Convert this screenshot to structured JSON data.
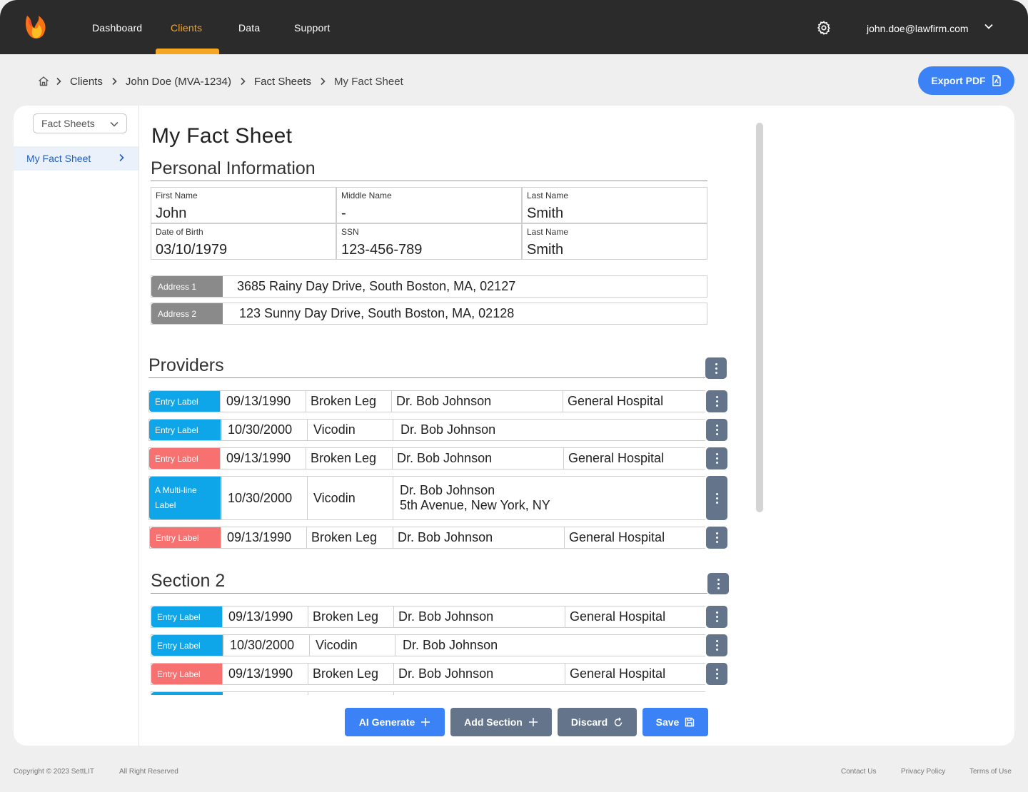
{
  "nav": {
    "items": [
      "Dashboard",
      "Clients",
      "Data",
      "Support"
    ],
    "active": "Clients",
    "user_email": "john.doe@lawfirm.com"
  },
  "breadcrumb": [
    "Clients",
    "John Doe (MVA-1234)",
    "Fact Sheets",
    "My Fact Sheet"
  ],
  "export_label": "Export PDF",
  "sidebar": {
    "select_value": "Fact Sheets",
    "items": [
      {
        "label": "My Fact Sheet"
      }
    ]
  },
  "page_title": "My Fact Sheet",
  "personal": {
    "title": "Personal Information",
    "fields": [
      {
        "label": "First Name",
        "value": "John"
      },
      {
        "label": "Middle Name",
        "value": "-"
      },
      {
        "label": "Last Name",
        "value": "Smith"
      },
      {
        "label": "Date of Birth",
        "value": "03/10/1979"
      },
      {
        "label": "SSN",
        "value": "123-456-789"
      },
      {
        "label": "Last Name",
        "value": "Smith"
      }
    ],
    "addresses": [
      {
        "label": "Address 1",
        "value": "3685 Rainy Day Drive, South Boston, MA, 02127"
      },
      {
        "label": "Address 2",
        "value": "123 Sunny Day Drive, South Boston, MA, 02128"
      }
    ]
  },
  "providers": {
    "title": "Providers",
    "rows": [
      {
        "label": "Entry Label",
        "color": "#0ea5e9",
        "date": "09/13/1990",
        "item": "Broken Leg",
        "doctor": "Dr. Bob Johnson",
        "doctor2": "",
        "place": "General Hospital"
      },
      {
        "label": "Entry Label",
        "color": "#0ea5e9",
        "date": "10/30/2000",
        "item": "Vicodin",
        "doctor": "Dr. Bob Johnson",
        "doctor2": "",
        "place": ""
      },
      {
        "label": "Entry Label",
        "color": "#f87171",
        "date": "09/13/1990",
        "item": "Broken Leg",
        "doctor": "Dr. Bob Johnson",
        "doctor2": "",
        "place": "General Hospital"
      },
      {
        "label": "A Multi-line Label",
        "color": "#0ea5e9",
        "date": "10/30/2000",
        "item": "Vicodin",
        "doctor": "Dr. Bob Johnson",
        "doctor2": "5th Avenue, New York, NY",
        "place": ""
      },
      {
        "label": "Entry Label",
        "color": "#f87171",
        "date": "09/13/1990",
        "item": "Broken Leg",
        "doctor": "Dr. Bob Johnson",
        "doctor2": "",
        "place": "General Hospital"
      }
    ]
  },
  "section2": {
    "title": "Section 2",
    "rows": [
      {
        "label": "Entry Label",
        "color": "#0ea5e9",
        "date": "09/13/1990",
        "item": "Broken Leg",
        "doctor": "Dr. Bob Johnson",
        "place": "General Hospital"
      },
      {
        "label": "Entry Label",
        "color": "#0ea5e9",
        "date": "10/30/2000",
        "item": "Vicodin",
        "doctor": "Dr. Bob Johnson",
        "place": ""
      },
      {
        "label": "Entry Label",
        "color": "#f87171",
        "date": "09/13/1990",
        "item": "Broken Leg",
        "doctor": "Dr. Bob Johnson",
        "place": "General Hospital"
      }
    ]
  },
  "actions": {
    "ai_generate": "AI Generate",
    "add_section": "Add Section",
    "discard": "Discard",
    "save": "Save"
  },
  "footer": {
    "copyright": "Copyright © 2023 SettLIT",
    "rights": "All Right Reserved",
    "links": [
      "Contact Us",
      "Privacy Policy",
      "Terms of Use"
    ]
  },
  "colors": {
    "accent": "#f5a623",
    "primary": "#3b82f6",
    "slate": "#64748b",
    "tag_blue": "#0ea5e9",
    "tag_red": "#f87171"
  }
}
